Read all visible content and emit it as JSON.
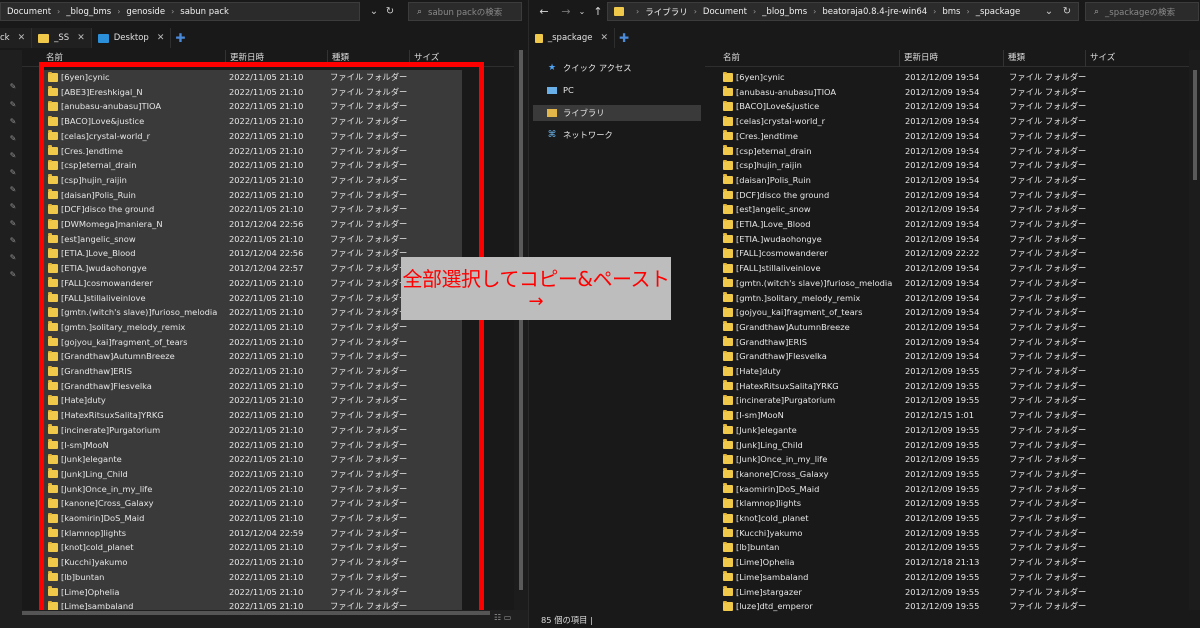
{
  "left": {
    "address": [
      "Document",
      "_blog_bms",
      "genoside",
      "sabun pack"
    ],
    "search_placeholder": "sabun packの検索",
    "tabs": [
      {
        "label": "ck",
        "color": "#f0c94a"
      },
      {
        "label": "_SS",
        "color": "#f0c94a"
      },
      {
        "label": "Desktop",
        "color": "#2b8fd9"
      }
    ],
    "columns": {
      "name": "名前",
      "date": "更新日時",
      "type": "種類",
      "size": "サイズ"
    },
    "rows": [
      {
        "name": "[6yen]cynic",
        "date": "2022/11/05 21:10",
        "type": "ファイル フォルダー"
      },
      {
        "name": "[ABE3]Ereshkigal_N",
        "date": "2022/11/05 21:10",
        "type": "ファイル フォルダー"
      },
      {
        "name": "[anubasu-anubasu]TIOA",
        "date": "2022/11/05 21:10",
        "type": "ファイル フォルダー"
      },
      {
        "name": "[BACO]Love&justice",
        "date": "2022/11/05 21:10",
        "type": "ファイル フォルダー"
      },
      {
        "name": "[celas]crystal-world_r",
        "date": "2022/11/05 21:10",
        "type": "ファイル フォルダー"
      },
      {
        "name": "[Cres.]endtime",
        "date": "2022/11/05 21:10",
        "type": "ファイル フォルダー"
      },
      {
        "name": "[csp]eternal_drain",
        "date": "2022/11/05 21:10",
        "type": "ファイル フォルダー"
      },
      {
        "name": "[csp]hujin_raijin",
        "date": "2022/11/05 21:10",
        "type": "ファイル フォルダー"
      },
      {
        "name": "[daisan]Polis_Ruin",
        "date": "2022/11/05 21:10",
        "type": "ファイル フォルダー"
      },
      {
        "name": "[DCF]disco the ground",
        "date": "2022/11/05 21:10",
        "type": "ファイル フォルダー"
      },
      {
        "name": "[DWMomega]maniera_N",
        "date": "2012/12/04 22:56",
        "type": "ファイル フォルダー"
      },
      {
        "name": "[est]angelic_snow",
        "date": "2022/11/05 21:10",
        "type": "ファイル フォルダー"
      },
      {
        "name": "[ETIA.]Love_Blood",
        "date": "2012/12/04 22:56",
        "type": "ファイル フォルダー"
      },
      {
        "name": "[ETIA.]wudaohongye",
        "date": "2012/12/04 22:57",
        "type": "ファイル フォルダー"
      },
      {
        "name": "[FALL]cosmowanderer",
        "date": "2022/11/05 21:10",
        "type": "ファイル フォルダー"
      },
      {
        "name": "[FALL]stillaliveinlove",
        "date": "2022/11/05 21:10",
        "type": "ファイル フォルダー"
      },
      {
        "name": "[gmtn.(witch's slave)]furioso_melodia",
        "date": "2022/11/05 21:10",
        "type": "ファイル フォルダー"
      },
      {
        "name": "[gmtn.]solitary_melody_remix",
        "date": "2022/11/05 21:10",
        "type": "ファイル フォルダー"
      },
      {
        "name": "[gojyou_kai]fragment_of_tears",
        "date": "2022/11/05 21:10",
        "type": "ファイル フォルダー"
      },
      {
        "name": "[Grandthaw]AutumnBreeze",
        "date": "2022/11/05 21:10",
        "type": "ファイル フォルダー"
      },
      {
        "name": "[Grandthaw]ERIS",
        "date": "2022/11/05 21:10",
        "type": "ファイル フォルダー"
      },
      {
        "name": "[Grandthaw]Flesvelka",
        "date": "2022/11/05 21:10",
        "type": "ファイル フォルダー"
      },
      {
        "name": "[Hate]duty",
        "date": "2022/11/05 21:10",
        "type": "ファイル フォルダー"
      },
      {
        "name": "[HatexRitsuxSalita]YRKG",
        "date": "2022/11/05 21:10",
        "type": "ファイル フォルダー"
      },
      {
        "name": "[incinerate]Purgatorium",
        "date": "2022/11/05 21:10",
        "type": "ファイル フォルダー"
      },
      {
        "name": "[I-sm]MooN",
        "date": "2022/11/05 21:10",
        "type": "ファイル フォルダー"
      },
      {
        "name": "[Junk]elegante",
        "date": "2022/11/05 21:10",
        "type": "ファイル フォルダー"
      },
      {
        "name": "[Junk]Ling_Child",
        "date": "2022/11/05 21:10",
        "type": "ファイル フォルダー"
      },
      {
        "name": "[Junk]Once_in_my_life",
        "date": "2022/11/05 21:10",
        "type": "ファイル フォルダー"
      },
      {
        "name": "[kanone]Cross_Galaxy",
        "date": "2022/11/05 21:10",
        "type": "ファイル フォルダー"
      },
      {
        "name": "[kaomirin]DoS_Maid",
        "date": "2022/11/05 21:10",
        "type": "ファイル フォルダー"
      },
      {
        "name": "[klamnop]lights",
        "date": "2012/12/04 22:59",
        "type": "ファイル フォルダー"
      },
      {
        "name": "[knot]cold_planet",
        "date": "2022/11/05 21:10",
        "type": "ファイル フォルダー"
      },
      {
        "name": "[Kucchi]yakumo",
        "date": "2022/11/05 21:10",
        "type": "ファイル フォルダー"
      },
      {
        "name": "[lb]buntan",
        "date": "2022/11/05 21:10",
        "type": "ファイル フォルダー"
      },
      {
        "name": "[Lime]Ophelia",
        "date": "2022/11/05 21:10",
        "type": "ファイル フォルダー"
      },
      {
        "name": "[Lime]sambaland",
        "date": "2022/11/05 21:10",
        "type": "ファイル フォルダー"
      }
    ]
  },
  "right": {
    "address": [
      "ライブラリ",
      "Document",
      "_blog_bms",
      "beatoraja0.8.4-jre-win64",
      "bms",
      "_spackage"
    ],
    "search_placeholder": "_spackageの検索",
    "tab": {
      "label": "_spackage"
    },
    "nav": [
      {
        "label": "クイック アクセス",
        "icon": "star-icon"
      },
      {
        "label": "PC",
        "icon": "pc-icon"
      },
      {
        "label": "ライブラリ",
        "icon": "library-icon"
      },
      {
        "label": "ネットワーク",
        "icon": "network-icon"
      }
    ],
    "columns": {
      "name": "名前",
      "date": "更新日時",
      "type": "種類",
      "size": "サイズ"
    },
    "rows": [
      {
        "name": "[6yen]cynic",
        "date": "2012/12/09 19:54",
        "type": "ファイル フォルダー"
      },
      {
        "name": "[anubasu-anubasu]TIOA",
        "date": "2012/12/09 19:54",
        "type": "ファイル フォルダー"
      },
      {
        "name": "[BACO]Love&justice",
        "date": "2012/12/09 19:54",
        "type": "ファイル フォルダー"
      },
      {
        "name": "[celas]crystal-world_r",
        "date": "2012/12/09 19:54",
        "type": "ファイル フォルダー"
      },
      {
        "name": "[Cres.]endtime",
        "date": "2012/12/09 19:54",
        "type": "ファイル フォルダー"
      },
      {
        "name": "[csp]eternal_drain",
        "date": "2012/12/09 19:54",
        "type": "ファイル フォルダー"
      },
      {
        "name": "[csp]hujin_raijin",
        "date": "2012/12/09 19:54",
        "type": "ファイル フォルダー"
      },
      {
        "name": "[daisan]Polis_Ruin",
        "date": "2012/12/09 19:54",
        "type": "ファイル フォルダー"
      },
      {
        "name": "[DCF]disco the ground",
        "date": "2012/12/09 19:54",
        "type": "ファイル フォルダー"
      },
      {
        "name": "[est]angelic_snow",
        "date": "2012/12/09 19:54",
        "type": "ファイル フォルダー"
      },
      {
        "name": "[ETIA.]Love_Blood",
        "date": "2012/12/09 19:54",
        "type": "ファイル フォルダー"
      },
      {
        "name": "[ETIA.]wudaohongye",
        "date": "2012/12/09 19:54",
        "type": "ファイル フォルダー"
      },
      {
        "name": "[FALL]cosmowanderer",
        "date": "2012/12/09 22:22",
        "type": "ファイル フォルダー"
      },
      {
        "name": "[FALL]stillaliveinlove",
        "date": "2012/12/09 19:54",
        "type": "ファイル フォルダー"
      },
      {
        "name": "[gmtn.(witch's slave)]furioso_melodia",
        "date": "2012/12/09 19:54",
        "type": "ファイル フォルダー"
      },
      {
        "name": "[gmtn.]solitary_melody_remix",
        "date": "2012/12/09 19:54",
        "type": "ファイル フォルダー"
      },
      {
        "name": "[gojyou_kai]fragment_of_tears",
        "date": "2012/12/09 19:54",
        "type": "ファイル フォルダー"
      },
      {
        "name": "[Grandthaw]AutumnBreeze",
        "date": "2012/12/09 19:54",
        "type": "ファイル フォルダー"
      },
      {
        "name": "[Grandthaw]ERIS",
        "date": "2012/12/09 19:54",
        "type": "ファイル フォルダー"
      },
      {
        "name": "[Grandthaw]Flesvelka",
        "date": "2012/12/09 19:54",
        "type": "ファイル フォルダー"
      },
      {
        "name": "[Hate]duty",
        "date": "2012/12/09 19:55",
        "type": "ファイル フォルダー"
      },
      {
        "name": "[HatexRitsuxSalita]YRKG",
        "date": "2012/12/09 19:55",
        "type": "ファイル フォルダー"
      },
      {
        "name": "[incinerate]Purgatorium",
        "date": "2012/12/09 19:55",
        "type": "ファイル フォルダー"
      },
      {
        "name": "[I-sm]MooN",
        "date": "2012/12/15 1:01",
        "type": "ファイル フォルダー"
      },
      {
        "name": "[Junk]elegante",
        "date": "2012/12/09 19:55",
        "type": "ファイル フォルダー"
      },
      {
        "name": "[Junk]Ling_Child",
        "date": "2012/12/09 19:55",
        "type": "ファイル フォルダー"
      },
      {
        "name": "[Junk]Once_in_my_life",
        "date": "2012/12/09 19:55",
        "type": "ファイル フォルダー"
      },
      {
        "name": "[kanone]Cross_Galaxy",
        "date": "2012/12/09 19:55",
        "type": "ファイル フォルダー"
      },
      {
        "name": "[kaomirin]DoS_Maid",
        "date": "2012/12/09 19:55",
        "type": "ファイル フォルダー"
      },
      {
        "name": "[klamnop]lights",
        "date": "2012/12/09 19:55",
        "type": "ファイル フォルダー"
      },
      {
        "name": "[knot]cold_planet",
        "date": "2012/12/09 19:55",
        "type": "ファイル フォルダー"
      },
      {
        "name": "[Kucchi]yakumo",
        "date": "2012/12/09 19:55",
        "type": "ファイル フォルダー"
      },
      {
        "name": "[lb]buntan",
        "date": "2012/12/09 19:55",
        "type": "ファイル フォルダー"
      },
      {
        "name": "[Lime]Ophelia",
        "date": "2012/12/18 21:13",
        "type": "ファイル フォルダー"
      },
      {
        "name": "[Lime]sambaland",
        "date": "2012/12/09 19:55",
        "type": "ファイル フォルダー"
      },
      {
        "name": "[Lime]stargazer",
        "date": "2012/12/09 19:55",
        "type": "ファイル フォルダー"
      },
      {
        "name": "[luze]dtd_emperor",
        "date": "2012/12/09 19:55",
        "type": "ファイル フォルダー"
      }
    ],
    "status": "85 個の項目 |"
  },
  "callout": {
    "line1": "全部選択してコピー&ペースト",
    "line2": "→"
  },
  "colors": {
    "accent_red": "#ff0000",
    "folder": "#f0c94a",
    "selection": "#3a3a3a"
  }
}
